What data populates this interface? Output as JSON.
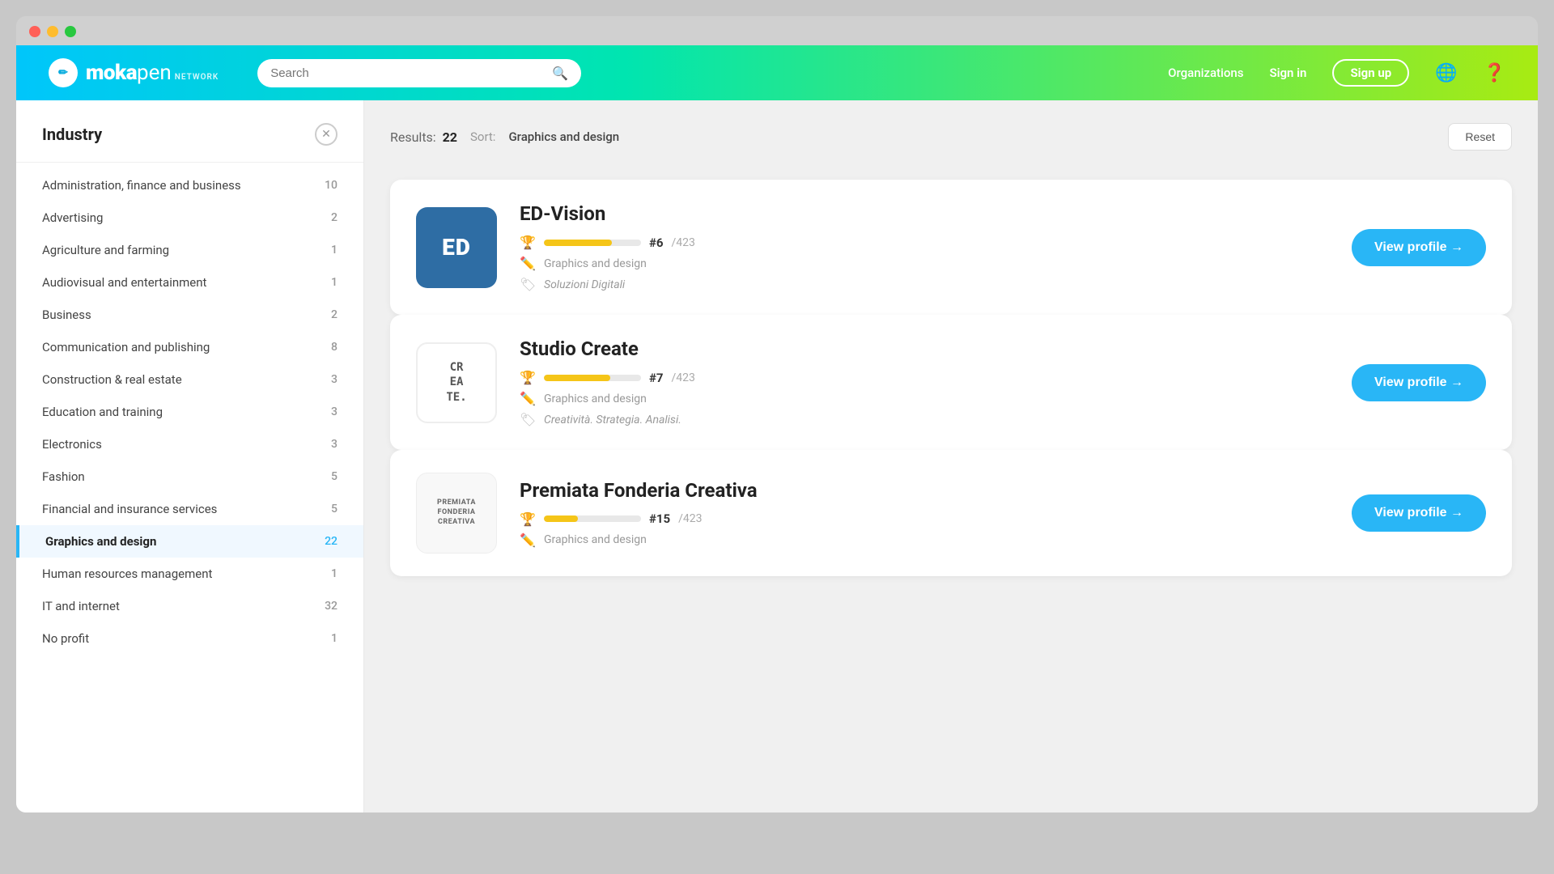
{
  "window": {
    "title": "Mokapen Network"
  },
  "header": {
    "logo": {
      "icon_text": "M",
      "moka": "moka",
      "pen": "pen",
      "network": "NETWORK"
    },
    "search": {
      "placeholder": "Search"
    },
    "nav": {
      "organizations": "Organizations",
      "signin": "Sign in",
      "signup": "Sign up"
    }
  },
  "sidebar": {
    "title": "Industry",
    "items": [
      {
        "label": "Administration, finance and business",
        "count": "10",
        "active": false
      },
      {
        "label": "Advertising",
        "count": "2",
        "active": false
      },
      {
        "label": "Agriculture and farming",
        "count": "1",
        "active": false
      },
      {
        "label": "Audiovisual and entertainment",
        "count": "1",
        "active": false
      },
      {
        "label": "Business",
        "count": "2",
        "active": false
      },
      {
        "label": "Communication and publishing",
        "count": "8",
        "active": false
      },
      {
        "label": "Construction & real estate",
        "count": "3",
        "active": false
      },
      {
        "label": "Education and training",
        "count": "3",
        "active": false
      },
      {
        "label": "Electronics",
        "count": "3",
        "active": false
      },
      {
        "label": "Fashion",
        "count": "5",
        "active": false
      },
      {
        "label": "Financial and insurance services",
        "count": "5",
        "active": false
      },
      {
        "label": "Graphics and design",
        "count": "22",
        "active": true
      },
      {
        "label": "Human resources management",
        "count": "1",
        "active": false
      },
      {
        "label": "IT and internet",
        "count": "32",
        "active": false
      },
      {
        "label": "No profit",
        "count": "1",
        "active": false
      }
    ]
  },
  "results": {
    "count_label": "Results:",
    "count": "22",
    "sort_label": "Sort:",
    "sort_value": "Graphics and design",
    "reset_label": "Reset"
  },
  "cards": [
    {
      "id": "ed-vision",
      "name": "ED-Vision",
      "logo_type": "ed",
      "logo_text": "ED",
      "rank": "#6",
      "rank_total": "/423",
      "rank_fill": 70,
      "industry": "Graphics and design",
      "tagline": "Soluzioni Digitali",
      "view_btn": "View profile →"
    },
    {
      "id": "studio-create",
      "name": "Studio Create",
      "logo_type": "create",
      "logo_text": "CR\nEA\nTE.",
      "rank": "#7",
      "rank_total": "/423",
      "rank_fill": 68,
      "industry": "Graphics and design",
      "tagline": "Creatività. Strategia. Analisi.",
      "view_btn": "View profile →"
    },
    {
      "id": "premiata-fonderia",
      "name": "Premiata Fonderia Creativa",
      "logo_type": "pfc",
      "logo_text": "PREMIATA\nFONDERIA\nCREATIVA",
      "rank": "#15",
      "rank_total": "/423",
      "rank_fill": 35,
      "industry": "Graphics and design",
      "tagline": "",
      "view_btn": "View profile →"
    }
  ]
}
